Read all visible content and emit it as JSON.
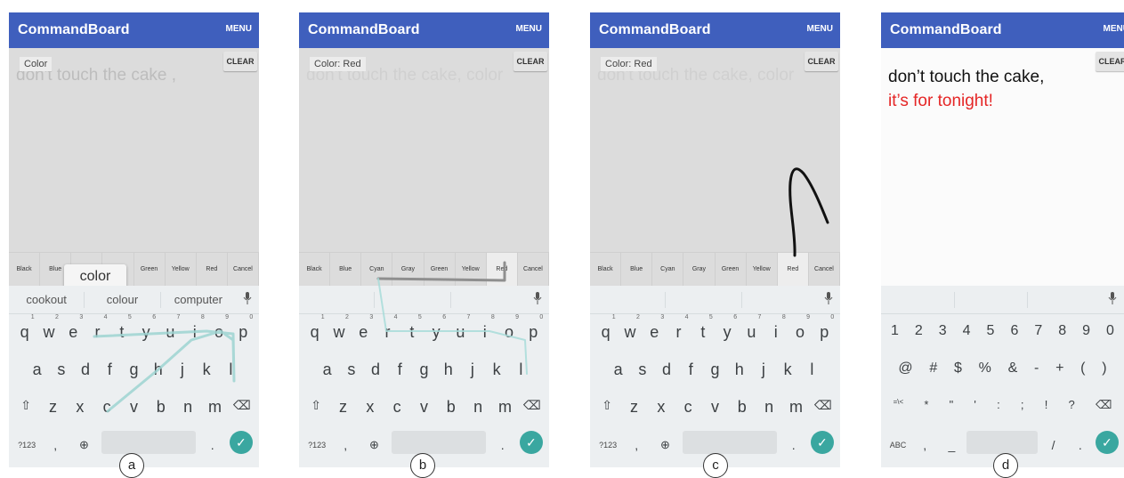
{
  "app_title": "CommandBoard",
  "menu_label": "MENU",
  "clear_label": "CLEAR",
  "panels": [
    {
      "label": "a",
      "command_label": "Color",
      "ghost_text": "don't touch the cake ,"
    },
    {
      "label": "b",
      "command_label": "Color: Red",
      "ghost_text": "don't touch the cake, color"
    },
    {
      "label": "c",
      "command_label": "Color: Red",
      "ghost_text": "don't touch the cake, color"
    },
    {
      "label": "d",
      "note_line1": "don’t touch the cake,",
      "note_line2": "it’s for tonight!"
    }
  ],
  "color_options": [
    "Black",
    "Blue",
    "Cyan",
    "Gray",
    "Green",
    "Yellow",
    "Red",
    "Cancel"
  ],
  "suggestions": [
    "cookout",
    "colour",
    "computer"
  ],
  "gesture_popup": "color",
  "keyboard": {
    "row1": [
      "q",
      "w",
      "e",
      "r",
      "t",
      "y",
      "u",
      "i",
      "o",
      "p"
    ],
    "row1_hints": [
      "1",
      "2",
      "3",
      "4",
      "5",
      "6",
      "7",
      "8",
      "9",
      "0"
    ],
    "row2": [
      "a",
      "s",
      "d",
      "f",
      "g",
      "h",
      "j",
      "k",
      "l"
    ],
    "row3": [
      "z",
      "x",
      "c",
      "v",
      "b",
      "n",
      "m"
    ],
    "shift_symbol": "⇧",
    "backspace_symbol": "⌫",
    "mode_label": "?123",
    "comma": ",",
    "period": ".",
    "globe_symbol": "⊕",
    "check_symbol": "✓",
    "mic_symbol": "🎤"
  },
  "symbols_keyboard": {
    "row1": [
      "1",
      "2",
      "3",
      "4",
      "5",
      "6",
      "7",
      "8",
      "9",
      "0"
    ],
    "row2": [
      "@",
      "#",
      "$",
      "%",
      "&",
      "-",
      "+",
      "(",
      ")"
    ],
    "row3": [
      "=\\<",
      "*",
      "\"",
      "'",
      ":",
      ";",
      "!",
      "?"
    ],
    "abc_label": "ABC",
    "comma": ",",
    "underscore": "_",
    "slash": "/",
    "period": "."
  },
  "accent_colors": {
    "appbar": "#3f5fbd",
    "confirm": "#3aa7a0",
    "highlight": "#e52626"
  }
}
